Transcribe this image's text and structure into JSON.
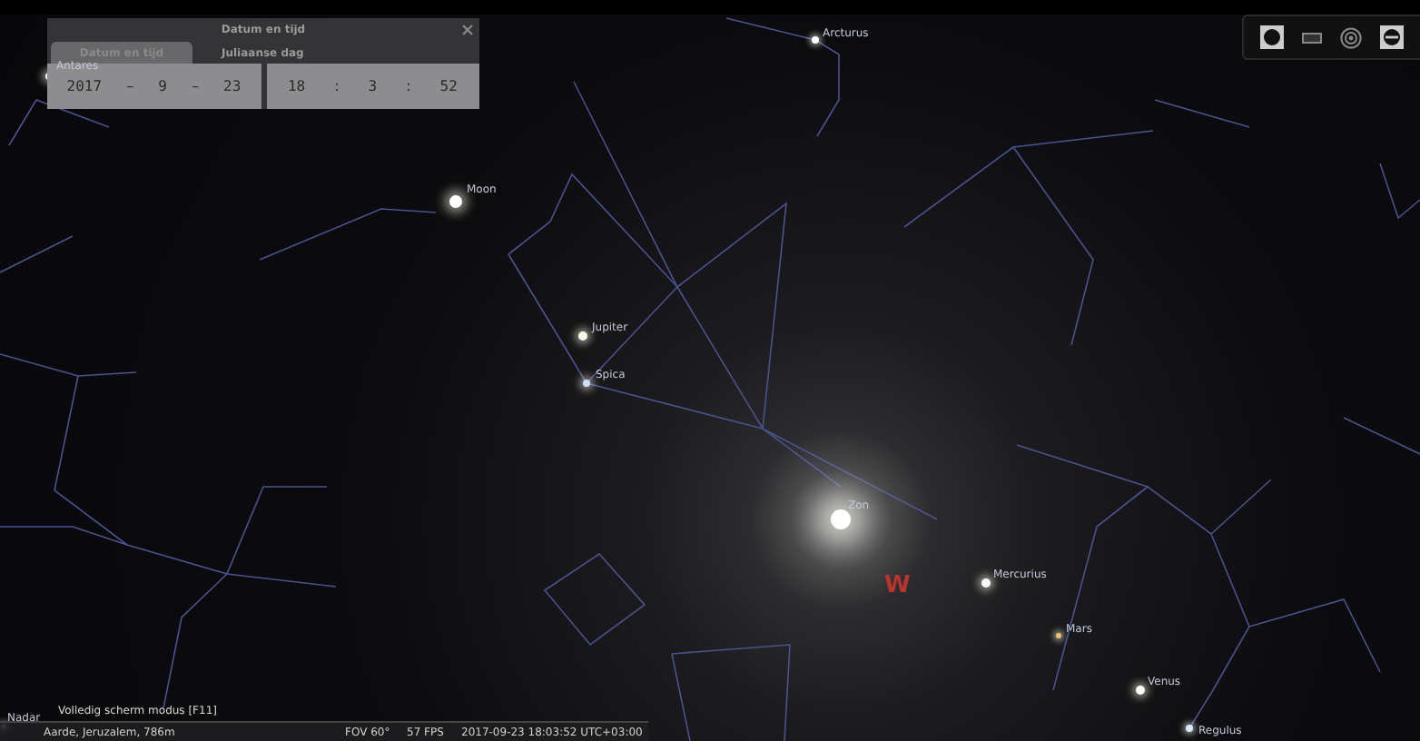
{
  "date_dialog": {
    "title": "Datum en tijd",
    "tabs": [
      {
        "label": "Datum en tijd",
        "selected": true
      },
      {
        "label": "Juliaanse dag",
        "selected": false
      }
    ],
    "date_fields": [
      "2017",
      "9",
      "23"
    ],
    "date_separators": [
      "–",
      "–"
    ],
    "time_fields": [
      "18",
      "3",
      "52"
    ],
    "time_separators": [
      ":",
      ":"
    ]
  },
  "sky_labels": [
    {
      "name": "Arcturus"
    },
    {
      "name": "Moon"
    },
    {
      "name": "Jupiter"
    },
    {
      "name": "Spica"
    },
    {
      "name": "Zon"
    },
    {
      "name": "Mercurius"
    },
    {
      "name": "Mars"
    },
    {
      "name": "Venus"
    },
    {
      "name": "Regulus"
    },
    {
      "name": "Antares"
    },
    {
      "name": "Nadar"
    }
  ],
  "compass": "W",
  "hint": "Volledig scherm modus [F11]",
  "status_bar": {
    "location": "Aarde, Jeruzalem, 786m",
    "fov": "FOV 60°",
    "fps": "57 FPS",
    "datetime": "2017-09-23 18:03:52 UTC+03:00"
  }
}
